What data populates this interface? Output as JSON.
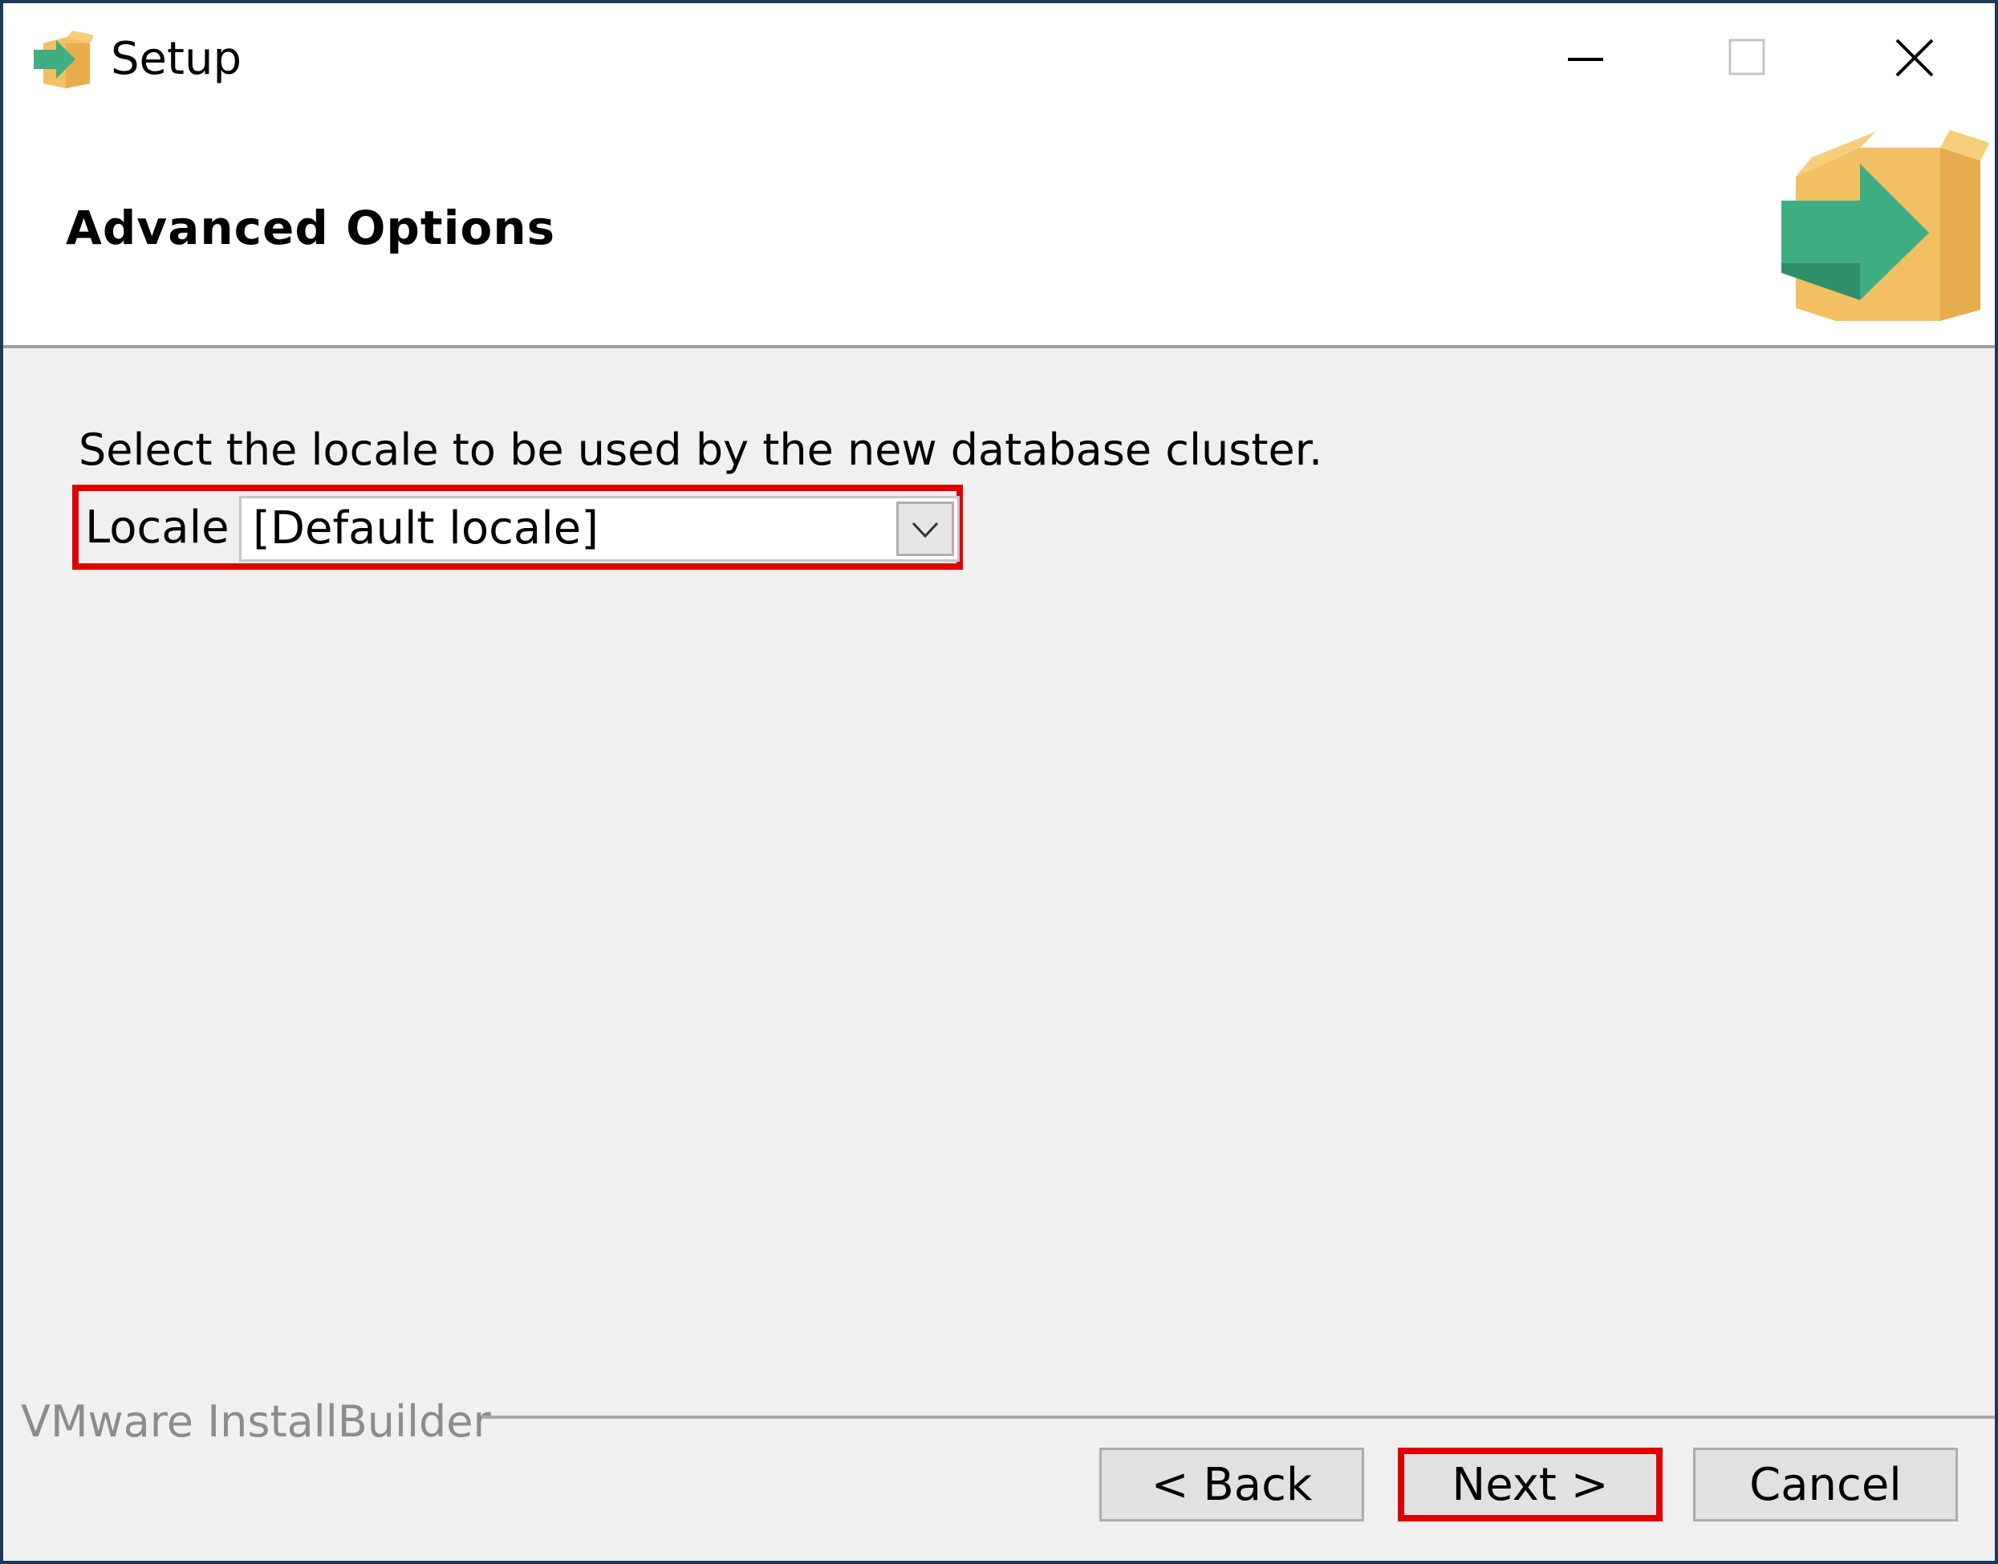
{
  "window": {
    "title": "Setup",
    "controls": {
      "minimize": "minimize-icon",
      "maximize": "maximize-icon",
      "close": "close-icon"
    }
  },
  "header": {
    "title": "Advanced Options",
    "logo": "installer-box-arrow-logo"
  },
  "content": {
    "instruction": "Select the locale to be used by the new database cluster.",
    "locale": {
      "label": "Locale",
      "value": "[Default locale]",
      "highlight_color": "#e10000"
    }
  },
  "footer": {
    "brand": "VMware InstallBuilder",
    "buttons": {
      "back": "< Back",
      "next": "Next >",
      "cancel": "Cancel"
    }
  },
  "colors": {
    "window_border": "#1c3a57",
    "body_bg": "#f0f0f0",
    "highlight": "#e10000",
    "logo_box": "#f2bf63",
    "logo_arrow": "#3fae83"
  }
}
